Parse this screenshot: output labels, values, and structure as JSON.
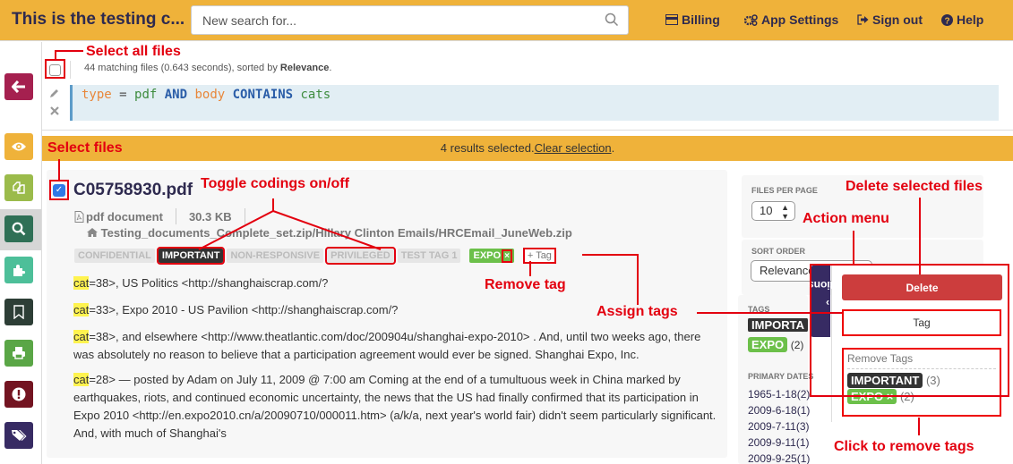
{
  "header": {
    "app_title": "This is the testing c...",
    "search_placeholder": "New search for...",
    "nav": [
      {
        "label": "Billing",
        "icon": "credit-card-icon"
      },
      {
        "label": "App Settings",
        "icon": "gears-icon"
      },
      {
        "label": "Sign out",
        "icon": "sign-out-icon"
      },
      {
        "label": "Help",
        "icon": "question-circle-icon"
      }
    ]
  },
  "sidebar": {
    "items": [
      {
        "name": "back",
        "icon": "arrow-left-icon",
        "color": "#a5204f"
      },
      {
        "name": "view",
        "icon": "eye-icon",
        "color": "#efb23a"
      },
      {
        "name": "duplicates",
        "icon": "copy-icon",
        "color": "#9bbb4b"
      },
      {
        "name": "search",
        "icon": "search-icon",
        "color": "#2f7056",
        "active": true
      },
      {
        "name": "plugins",
        "icon": "puzzle-icon",
        "color": "#4dbf99"
      },
      {
        "name": "bookmarks",
        "icon": "bookmark-icon",
        "color": "#2d3e36"
      },
      {
        "name": "print",
        "icon": "print-icon",
        "color": "#5aa646"
      },
      {
        "name": "alerts",
        "icon": "exclamation-icon",
        "color": "#731421"
      },
      {
        "name": "tags",
        "icon": "tags-icon",
        "color": "#372b63"
      }
    ]
  },
  "results": {
    "match_count_text": "44 matching files (0.643 seconds), sorted by ",
    "sort_label": "Relevance",
    "period": ".",
    "query": {
      "t1": "type",
      "t2": " = ",
      "t3": "pdf",
      "t4": " AND ",
      "t5": "body",
      "t6": " CONTAINS ",
      "t7": "cats"
    },
    "selection_text": "4 results selected.",
    "clear_selection": "Clear selection",
    "selection_end": "."
  },
  "file": {
    "name": "C05758930.pdf",
    "type": "pdf document",
    "size": "30.3 KB",
    "path": "Testing_documents_Complete_set.zip/Hillary Clinton Emails/HRCEmail_JuneWeb.zip",
    "codings": [
      {
        "label": "CONFIDENTIAL",
        "on": false
      },
      {
        "label": "IMPORTANT",
        "on": true
      },
      {
        "label": "NON-RESPONSIVE",
        "on": false
      },
      {
        "label": "PRIVILEGED",
        "on": false
      },
      {
        "label": "TEST TAG 1",
        "on": false
      }
    ],
    "tag": "EXPO",
    "tag_remove": "×",
    "add_tag": "Tag",
    "snippets": [
      {
        "hl": "cat",
        "text": "=38>, US Politics <http://shanghaiscrap.com/?"
      },
      {
        "hl": "cat",
        "text": "=33>, Expo 2010 - US Pavilion <http://shanghaiscrap.com/?"
      },
      {
        "hl": "cat",
        "text": "=38>, and elsewhere <http://www.theatlantic.com/doc/200904u/shanghai-expo-2010> . And, until two weeks ago, there was absolutely no reason to believe that a participation agreement would ever be signed. Shanghai Expo, Inc."
      },
      {
        "hl": "cat",
        "text": "=28> — posted by Adam on July 11, 2009 @ 7:00 am Coming at the end of a tumultuous week in China marked by earthquakes, riots, and continued economic uncertainty, the news that the US had finally confirmed that its participation in Expo 2010 <http://en.expo2010.cn/a/20090710/000011.htm> (a/k/a, next year's world fair) didn't seem particularly significant. And, with much of Shanghai's"
      }
    ]
  },
  "right_panel": {
    "files_per_page_label": "FILES PER PAGE",
    "files_per_page_value": "10",
    "sort_order_label": "SORT ORDER",
    "sort_order_value": "Relevance",
    "tags_label": "TAGS",
    "tags": [
      {
        "label": "IMPORTA",
        "count": ""
      },
      {
        "label": "EXPO",
        "count": "(2)"
      }
    ],
    "primary_dates_label": "PRIMARY DATES",
    "dates": [
      "1965-1-18(2)",
      "2009-6-18(1)",
      "2009-7-11(3)",
      "2009-9-11(1)",
      "2009-9-25(1)"
    ]
  },
  "actions": {
    "tab_label": "Actions",
    "delete_label": "Delete",
    "tag_label": "Tag",
    "remove_tags_title": "Remove Tags",
    "remove_tags": [
      {
        "label": "IMPORTANT",
        "count": "(3)"
      },
      {
        "label": "EXPO",
        "count": "(2)",
        "removable": true
      }
    ]
  },
  "annotations": {
    "select_all": "Select all files",
    "select_files": "Select files",
    "toggle_codings": "Toggle codings on/off",
    "remove_tag": "Remove tag",
    "assign_tags": "Assign tags",
    "delete_selected": "Delete selected files",
    "action_menu": "Action menu",
    "click_remove": "Click to remove tags"
  }
}
